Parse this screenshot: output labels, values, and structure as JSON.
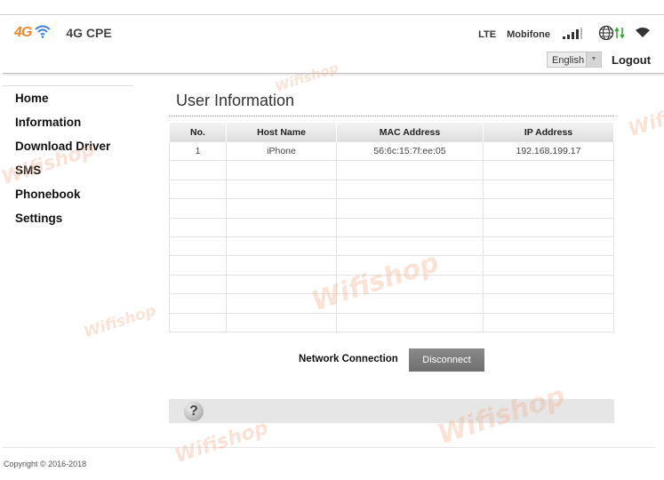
{
  "brand": {
    "badge": "4G",
    "name": "4G CPE"
  },
  "status": {
    "network": "LTE",
    "carrier": "Mobifone"
  },
  "language": {
    "selected": "English"
  },
  "header": {
    "logout_label": "Logout"
  },
  "nav": {
    "items": [
      {
        "label": "Home"
      },
      {
        "label": "Information"
      },
      {
        "label": "Download Driver"
      },
      {
        "label": "SMS"
      },
      {
        "label": "Phonebook"
      },
      {
        "label": "Settings"
      }
    ]
  },
  "page": {
    "title": "User Information"
  },
  "table": {
    "headers": [
      "No.",
      "Host Name",
      "MAC Address",
      "IP Address"
    ],
    "rows": [
      [
        "1",
        "iPhone",
        "56:6c:15:7f:ee:05",
        "192.168.199.17"
      ]
    ],
    "empty_rows": 9
  },
  "network": {
    "label": "Network Connection",
    "button": "Disconnect"
  },
  "help": {
    "icon": "help-icon"
  },
  "footer": {
    "copyright": "Copyright © 2016-2018"
  },
  "watermark": {
    "text": "Wifishop"
  },
  "colors": {
    "brand_orange": "#e8892c",
    "wifi_blue": "#3a7ed6",
    "button_gray": "#7a7a7a",
    "arrow_green": "#3da63d"
  }
}
